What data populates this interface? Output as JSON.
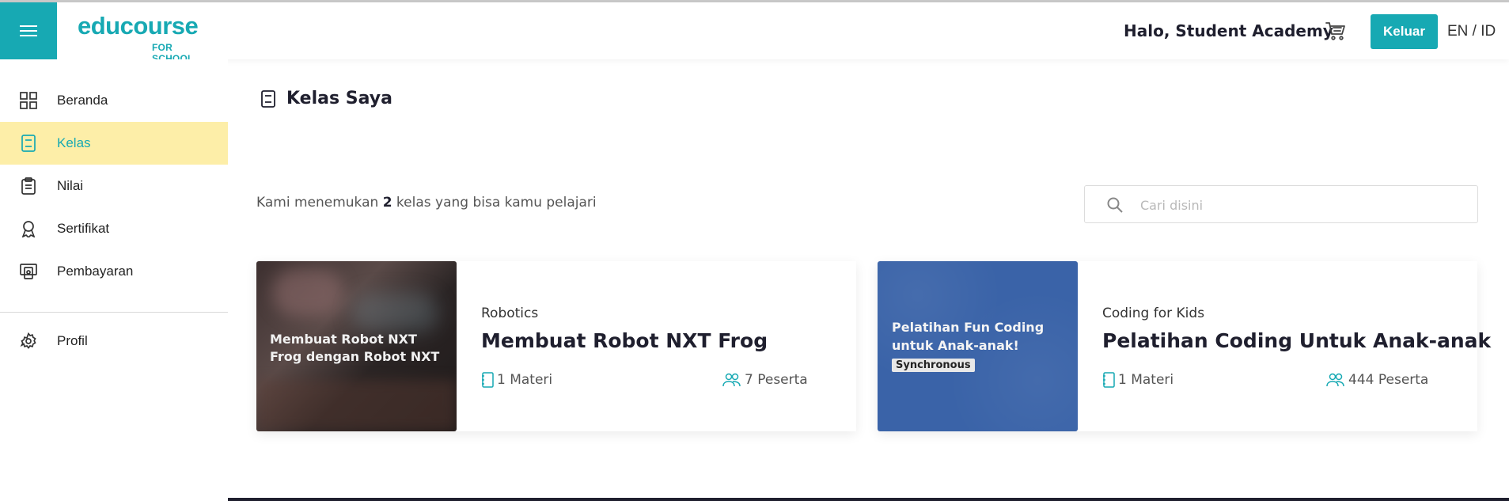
{
  "header": {
    "logo_main": "educourse",
    "logo_sub": "FOR SCHOOL",
    "greeting": "Halo, Student Academy",
    "logout_label": "Keluar",
    "lang_en": "EN",
    "lang_sep": " / ",
    "lang_id": "ID"
  },
  "sidebar": {
    "items": [
      {
        "label": "Beranda",
        "icon": "grid-icon"
      },
      {
        "label": "Kelas",
        "icon": "book-icon",
        "active": true
      },
      {
        "label": "Nilai",
        "icon": "clipboard-icon"
      },
      {
        "label": "Sertifikat",
        "icon": "award-icon"
      },
      {
        "label": "Pembayaran",
        "icon": "payment-icon"
      }
    ],
    "profile_label": "Profil"
  },
  "main": {
    "title": "Kelas Saya",
    "summary_prefix": "Kami menemukan ",
    "summary_count": "2",
    "summary_suffix": " kelas yang bisa kamu pelajari",
    "search_placeholder": "Cari disini"
  },
  "courses": [
    {
      "category": "Robotics",
      "title": "Membuat Robot NXT Frog",
      "image_text": "Membuat Robot NXT Frog dengan Robot NXT",
      "materials": "1 Materi",
      "participants": "7 Peserta"
    },
    {
      "category": "Coding for Kids",
      "title": "Pelatihan Coding Untuk Anak-anak",
      "image_text": "Pelatihan Fun Coding untuk Anak-anak!",
      "image_badge": "Synchronous",
      "materials": "1 Materi",
      "participants": "444 Peserta"
    }
  ],
  "colors": {
    "brand": "#17a9b3",
    "active_bg": "#fdeea8",
    "dark_text": "#1f1f2e"
  }
}
